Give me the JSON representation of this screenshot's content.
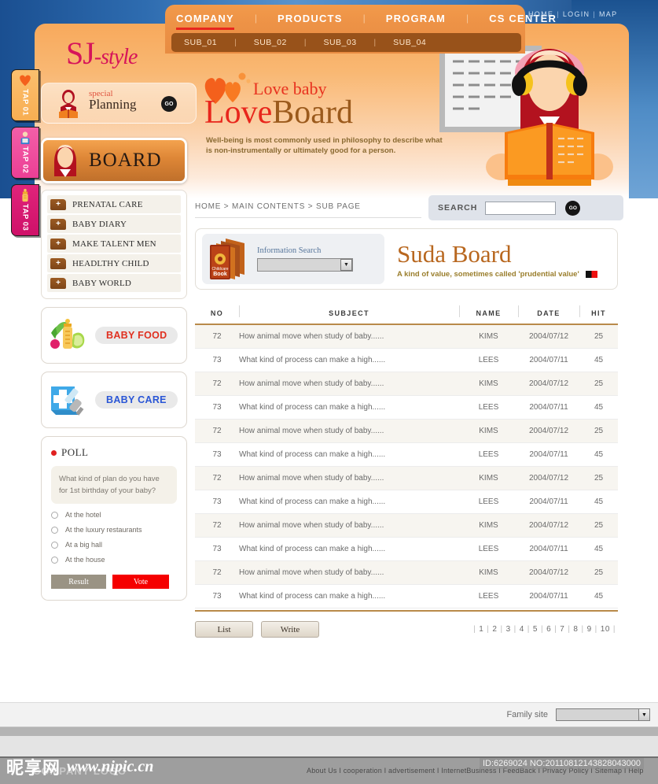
{
  "topnav": {
    "items": [
      {
        "label": "COMPANY",
        "active": true
      },
      {
        "label": "PRODUCTS",
        "active": false
      },
      {
        "label": "PROGRAM",
        "active": false
      },
      {
        "label": "CS CENTER",
        "active": false
      }
    ],
    "sub_items": [
      "SUB_01",
      "SUB_02",
      "SUB_03",
      "SUB_04"
    ],
    "utility": [
      "HOME",
      "LOGIN",
      "MAP"
    ]
  },
  "brand": {
    "logo_main": "SJ",
    "logo_suffix": "-style"
  },
  "planning": {
    "kicker": "special",
    "title": "Planning",
    "go_label": "GO"
  },
  "hero": {
    "line1": "Love baby",
    "line2_a": "Love",
    "line2_b": "Board",
    "desc": "Well-being is most commonly used in philosophy to describe what is non-instrumentally or ultimately good for a person."
  },
  "taps": [
    {
      "label": "TAP 01",
      "icon": "heart-icon"
    },
    {
      "label": "TAP 02",
      "icon": "person-icon"
    },
    {
      "label": "TAP 03",
      "icon": "bottle-icon"
    }
  ],
  "sidebar": {
    "board_button": "BOARD",
    "menu": [
      {
        "label": "PRENATAL CARE",
        "plus": "+"
      },
      {
        "label": "BABY DIARY",
        "plus": "+"
      },
      {
        "label": "MAKE TALENT MEN",
        "plus": "+"
      },
      {
        "label": "HEADLTHY CHILD",
        "plus": "+"
      },
      {
        "label": "BABY WORLD",
        "plus": "+"
      }
    ],
    "cards": [
      {
        "label": "BABY FOOD",
        "icon": "baby-food-icon"
      },
      {
        "label": "BABY CARE",
        "icon": "baby-care-icon"
      }
    ],
    "poll": {
      "title": "POLL",
      "question": "What kind of plan do you have for 1st birthday of your baby?",
      "options": [
        "At the hotel",
        "At the luxury restaurants",
        "At a big hall",
        "At the house"
      ],
      "result_label": "Result",
      "vote_label": "Vote"
    }
  },
  "content": {
    "breadcrumb": "HOME > MAIN CONTENTS > SUB PAGE",
    "search": {
      "label": "SEARCH",
      "value": "",
      "placeholder": "",
      "go_label": "GO"
    },
    "info_search": {
      "label": "Information Search",
      "selected": "",
      "book_caption_small": "Childcare",
      "book_caption": "Book"
    },
    "board": {
      "title": "Suda Board",
      "subtitle": "A kind of value, sometimes called 'prudential value'"
    },
    "table": {
      "columns": [
        "NO",
        "SUBJECT",
        "NAME",
        "DATE",
        "HIT"
      ],
      "rows": [
        {
          "no": "72",
          "subject": "How animal move when study of baby......",
          "name": "KIMS",
          "date": "2004/07/12",
          "hit": "25"
        },
        {
          "no": "73",
          "subject": "What kind of process can make a high......",
          "name": "LEES",
          "date": "2004/07/11",
          "hit": "45"
        },
        {
          "no": "72",
          "subject": "How animal move when study of baby......",
          "name": "KIMS",
          "date": "2004/07/12",
          "hit": "25"
        },
        {
          "no": "73",
          "subject": "What kind of process can make a high......",
          "name": "LEES",
          "date": "2004/07/11",
          "hit": "45"
        },
        {
          "no": "72",
          "subject": "How animal move when study of baby......",
          "name": "KIMS",
          "date": "2004/07/12",
          "hit": "25"
        },
        {
          "no": "73",
          "subject": "What kind of process can make a high......",
          "name": "LEES",
          "date": "2004/07/11",
          "hit": "45"
        },
        {
          "no": "72",
          "subject": "How animal move when study of baby......",
          "name": "KIMS",
          "date": "2004/07/12",
          "hit": "25"
        },
        {
          "no": "73",
          "subject": "What kind of process can make a high......",
          "name": "LEES",
          "date": "2004/07/11",
          "hit": "45"
        },
        {
          "no": "72",
          "subject": "How animal move when study of baby......",
          "name": "KIMS",
          "date": "2004/07/12",
          "hit": "25"
        },
        {
          "no": "73",
          "subject": "What kind of process can make a high......",
          "name": "LEES",
          "date": "2004/07/11",
          "hit": "45"
        },
        {
          "no": "72",
          "subject": "How animal move when study of baby......",
          "name": "KIMS",
          "date": "2004/07/12",
          "hit": "25"
        },
        {
          "no": "73",
          "subject": "What kind of process can make a high......",
          "name": "LEES",
          "date": "2004/07/11",
          "hit": "45"
        }
      ]
    },
    "actions": {
      "list_label": "List",
      "write_label": "Write"
    },
    "pagination": [
      "1",
      "2",
      "3",
      "4",
      "5",
      "6",
      "7",
      "8",
      "9",
      "10"
    ]
  },
  "footer": {
    "family_site_label": "Family site",
    "family_site_value": "",
    "links": "About Us I cooperation I advertisement I InternetBusiness I FeedBack I Privacy Policy I Sitemap I Help",
    "company_logo": "COMPANY LOGO",
    "overlay_id": "ID:6269024 NO:20110812143828043000"
  },
  "watermark": {
    "cn": "昵享网",
    "url": "www.nipic.cn"
  },
  "colors": {
    "orange": "#ed9246",
    "brown": "#98521a",
    "red": "#e8271f",
    "blue": "#2e6cb0",
    "board_title": "#b8671f"
  }
}
